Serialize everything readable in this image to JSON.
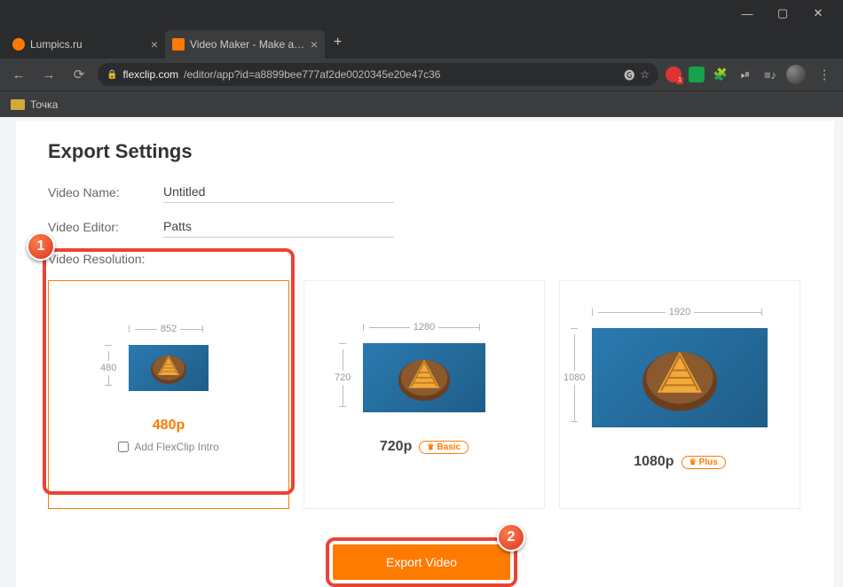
{
  "window": {
    "tabs": [
      {
        "title": "Lumpics.ru",
        "active": false
      },
      {
        "title": "Video Maker - Make a Video for",
        "active": true
      }
    ],
    "newtab_label": "+",
    "controls": {
      "min": "—",
      "max": "▢",
      "close": "✕"
    }
  },
  "addr": {
    "back": "←",
    "forward": "→",
    "reload": "⟳",
    "lock": "🔒",
    "url_host": "flexclip.com",
    "url_path": "/editor/app?id=a8899bee777af2de0020345e20e47c36",
    "translate_icon": "⭑",
    "ext_badge": "1",
    "menu": "⋮"
  },
  "bookmarks": {
    "item1": "Точка"
  },
  "page": {
    "title": "Export Settings",
    "video_name_label": "Video Name:",
    "video_name_value": "Untitled",
    "video_editor_label": "Video Editor:",
    "video_editor_value": "Patts",
    "video_resolution_label": "Video Resolution:",
    "resolutions": [
      {
        "w": "852",
        "h": "480",
        "name": "480p",
        "badge": "",
        "selected": true,
        "thumb_w": 90,
        "thumb_h": 52,
        "intro_label": "Add FlexClip Intro"
      },
      {
        "w": "1280",
        "h": "720",
        "name": "720p",
        "badge": "Basic",
        "selected": false,
        "thumb_w": 138,
        "thumb_h": 78
      },
      {
        "w": "1920",
        "h": "1080",
        "name": "1080p",
        "badge": "Plus",
        "selected": false,
        "thumb_w": 198,
        "thumb_h": 112
      }
    ],
    "export_button": "Export Video"
  },
  "annotations": {
    "n1": "1",
    "n2": "2"
  }
}
